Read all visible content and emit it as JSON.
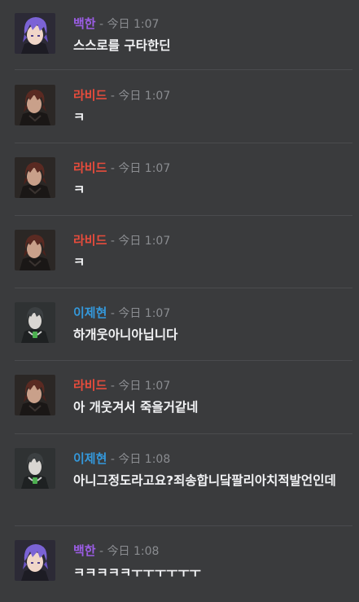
{
  "colors": {
    "background": "#3a3b3d",
    "divider": "#4a4b4e",
    "timestamp": "#8a8c90",
    "user_baekhan": "#9b5de5",
    "user_ravid": "#e74c3c",
    "user_ijehyeon": "#3498db"
  },
  "separator": " - ",
  "messages": [
    {
      "author": "백한",
      "author_color": "#9b5de5",
      "avatar": "purple-hair-avatar",
      "time": "今日 1:07",
      "text": "스스로를 구타한딘"
    },
    {
      "author": "라비드",
      "author_color": "#e74c3c",
      "avatar": "dark-hair-avatar",
      "time": "今日 1:07",
      "text": "ㅋ"
    },
    {
      "author": "라비드",
      "author_color": "#e74c3c",
      "avatar": "dark-hair-avatar",
      "time": "今日 1:07",
      "text": "ㅋ"
    },
    {
      "author": "라비드",
      "author_color": "#e74c3c",
      "avatar": "dark-hair-avatar",
      "time": "今日 1:07",
      "text": "ㅋ"
    },
    {
      "author": "이제현",
      "author_color": "#3498db",
      "avatar": "gray-avatar",
      "time": "今日 1:07",
      "text": "하개웃아니아닙니다"
    },
    {
      "author": "라비드",
      "author_color": "#e74c3c",
      "avatar": "dark-hair-avatar",
      "time": "今日 1:07",
      "text": "아 개웃겨서 죽을거같네"
    },
    {
      "author": "이제현",
      "author_color": "#3498db",
      "avatar": "gray-avatar",
      "time": "今日 1:08",
      "text": "아니그정도라고요?죄송합니닼팔리아치적발언인데"
    },
    {
      "author": "백한",
      "author_color": "#9b5de5",
      "avatar": "purple-hair-avatar",
      "time": "今日 1:08",
      "text": "ㅋㅋㅋㅋㅋㅜㅜㅜㅜㅜㅜ"
    }
  ]
}
